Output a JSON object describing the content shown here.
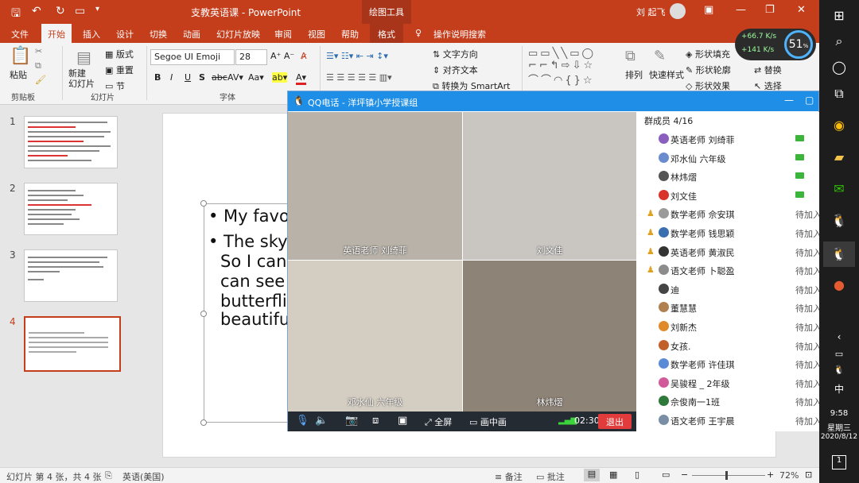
{
  "titlebar": {
    "doc_title": "支教英语课 - PowerPoint",
    "context_tab": "绘图工具",
    "user": "刘 起飞"
  },
  "tabs": [
    "文件",
    "开始",
    "插入",
    "设计",
    "切换",
    "动画",
    "幻灯片放映",
    "审阅",
    "视图",
    "帮助",
    "格式",
    "操作说明搜索"
  ],
  "ribbon": {
    "paste": "粘贴",
    "clipboard": "剪贴板",
    "layout": "版式",
    "reset": "重置",
    "new_slide": "新建\n幻灯片",
    "section": "节",
    "slides_group": "幻灯片",
    "font_name": "Segoe UI Emoji",
    "font_size": "28",
    "font_group": "字体",
    "text_direction": "文字方向",
    "align_text": "对齐文本",
    "smartart": "转换为 SmartArt",
    "arrange": "排列",
    "quick_styles": "快速样式",
    "shape_fill": "形状填充",
    "shape_outline": "形状轮廓",
    "shape_effects": "形状效果",
    "replace": "替换",
    "select": "选择",
    "net_up": "+66.7",
    "net_up_unit": "K/s",
    "net_down": "+141",
    "net_down_unit": "K/s",
    "net_percent": "51",
    "net_percent_unit": "%"
  },
  "thumbnails": [
    {
      "num": "1"
    },
    {
      "num": "2"
    },
    {
      "num": "3"
    },
    {
      "num": "4"
    }
  ],
  "slide": {
    "line1": "• My favor",
    "line2": "• The sky i",
    "line3": "So I can",
    "line4": "can see m",
    "line5": "butterflie",
    "line6": "beautifu"
  },
  "status": {
    "slide_info": "幻灯片 第 4 张，共 4 张",
    "language": "英语(美国)",
    "notes": "备注",
    "comments": "批注",
    "zoom": "72%"
  },
  "qq": {
    "title": "QQ电话 - 洋坪镇小学授课组",
    "members_header": "群成员 4/16",
    "videos": [
      {
        "name": "英语老师 刘绮菲",
        "bg": "#b8b2a8"
      },
      {
        "name": "刘文佳",
        "bg": "#c9c6c2"
      },
      {
        "name": "邓水仙 六年级",
        "bg": "#d4cdc2"
      },
      {
        "name": "林炜熠",
        "bg": "#8e8377"
      }
    ],
    "members": [
      {
        "name": "英语老师 刘绮菲",
        "status": "",
        "cam": true,
        "teacher": false,
        "av": "#8a5fbf"
      },
      {
        "name": "邓水仙  六年级",
        "status": "",
        "cam": true,
        "teacher": false,
        "av": "#6a8ccf"
      },
      {
        "name": "林炜熠",
        "status": "",
        "cam": true,
        "teacher": false,
        "av": "#555555"
      },
      {
        "name": "刘文佳",
        "status": "",
        "cam": true,
        "teacher": false,
        "av": "#d9342b"
      },
      {
        "name": "数学老师 佘安琪",
        "status": "待加入",
        "cam": false,
        "teacher": true,
        "av": "#9a9a9a"
      },
      {
        "name": "数学老师 钱思颖",
        "status": "待加入",
        "cam": false,
        "teacher": true,
        "av": "#3a6fb0"
      },
      {
        "name": "英语老师 黄淑民",
        "status": "待加入",
        "cam": false,
        "teacher": true,
        "av": "#333333"
      },
      {
        "name": "语文老师 卜聪盈",
        "status": "待加入",
        "cam": false,
        "teacher": true,
        "av": "#8c8c8c"
      },
      {
        "name": "迪",
        "status": "待加入",
        "cam": false,
        "teacher": false,
        "av": "#444444"
      },
      {
        "name": "董慧慧",
        "status": "待加入",
        "cam": false,
        "teacher": false,
        "av": "#b08050"
      },
      {
        "name": "刘新杰",
        "status": "待加入",
        "cam": false,
        "teacher": false,
        "av": "#e08a2a"
      },
      {
        "name": "女孩.",
        "status": "待加入",
        "cam": false,
        "teacher": false,
        "av": "#c2602a"
      },
      {
        "name": "数学老师 许佳琪",
        "status": "待加入",
        "cam": false,
        "teacher": false,
        "av": "#5b8ad6"
      },
      {
        "name": "吴骏程 _ 2年级",
        "status": "待加入",
        "cam": false,
        "teacher": false,
        "av": "#d25a9a"
      },
      {
        "name": "佘俊南一1班",
        "status": "待加入",
        "cam": false,
        "teacher": false,
        "av": "#2f7a3a"
      },
      {
        "name": "语文老师 王宇晨",
        "status": "待加入",
        "cam": false,
        "teacher": false,
        "av": "#7a8fa6"
      }
    ],
    "fullscreen": "全屏",
    "pip": "画中画",
    "duration": "02:30",
    "exit": "退出"
  },
  "taskbar": {
    "time": "9:58",
    "weekday": "星期三",
    "date": "2020/8/12",
    "ime": "中",
    "notifications": "1"
  },
  "colors": {
    "ppt_red": "#c43e1c",
    "qq_blue": "#1f8ee6",
    "exit_red": "#e23b3b"
  }
}
